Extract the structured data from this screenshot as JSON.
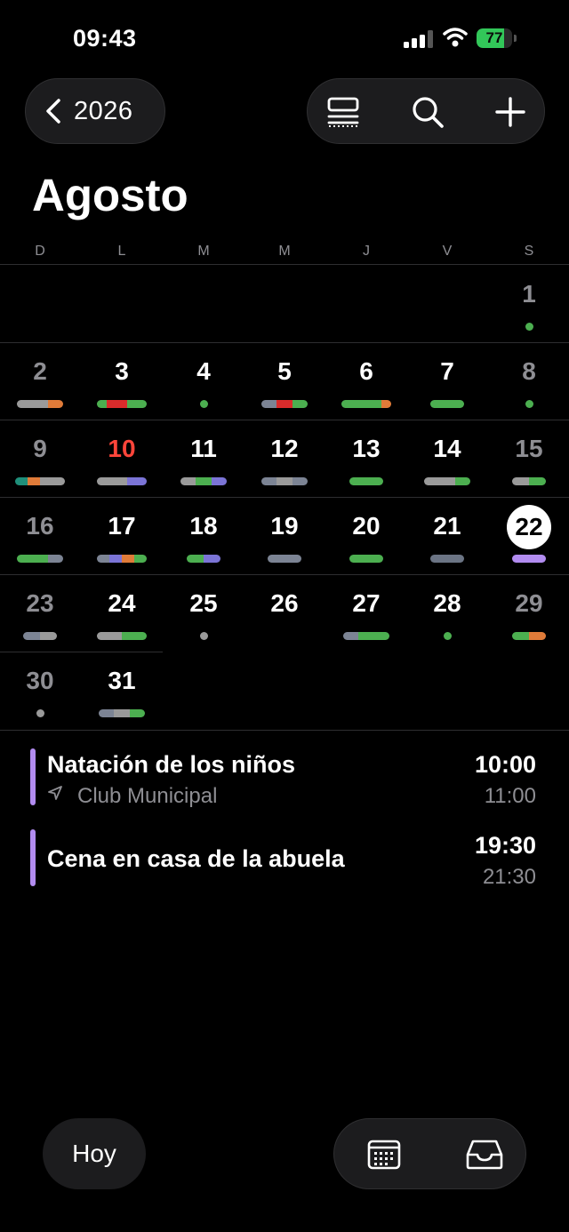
{
  "status_bar": {
    "time": "09:43",
    "battery": "77"
  },
  "header": {
    "back_label": "2026",
    "month": "Agosto"
  },
  "toolbar": {
    "icons": [
      "list-view-icon",
      "search-icon",
      "plus-icon"
    ]
  },
  "weekdays": [
    "D",
    "L",
    "M",
    "M",
    "J",
    "V",
    "S"
  ],
  "days": [
    {
      "d": "1",
      "dots": [
        "#4caf50"
      ]
    },
    {
      "d": "2",
      "bar": [
        "#9a9a9a",
        "#9a9a9a",
        "#e07b39"
      ]
    },
    {
      "d": "3",
      "bar": [
        "#4caf50",
        "#d92b2b",
        "#d92b2b",
        "#4caf50",
        "#4caf50"
      ]
    },
    {
      "d": "4",
      "dots": [
        "#4caf50"
      ]
    },
    {
      "d": "5",
      "bar": [
        "#7c8494",
        "#d92b2b",
        "#4caf50"
      ]
    },
    {
      "d": "6",
      "bar": [
        "#4caf50",
        "#4caf50",
        "#4caf50",
        "#4caf50",
        "#e07b39"
      ]
    },
    {
      "d": "7",
      "bar": [
        "#4caf50",
        "#4caf50"
      ]
    },
    {
      "d": "8",
      "dots": [
        "#4caf50"
      ]
    },
    {
      "d": "9",
      "bar": [
        "#1f8f7a",
        "#e07b39",
        "#9a9a9a",
        "#9a9a9a"
      ]
    },
    {
      "d": "10",
      "bar": [
        "#9a9a9a",
        "#9a9a9a",
        "#9a9a9a",
        "#7b74d6",
        "#7b74d6"
      ]
    },
    {
      "d": "11",
      "bar": [
        "#9a9a9a",
        "#4caf50",
        "#7b74d6"
      ]
    },
    {
      "d": "12",
      "bar": [
        "#7c8494",
        "#9a9a9a",
        "#7c8494"
      ]
    },
    {
      "d": "13",
      "bar": [
        "#4caf50",
        "#4caf50"
      ]
    },
    {
      "d": "14",
      "bar": [
        "#9a9a9a",
        "#9a9a9a",
        "#4caf50"
      ]
    },
    {
      "d": "15",
      "bar": [
        "#9a9a9a",
        "#4caf50"
      ]
    },
    {
      "d": "16",
      "bar": [
        "#4caf50",
        "#4caf50",
        "#7c8494"
      ]
    },
    {
      "d": "17",
      "bar": [
        "#7c8494",
        "#7b74d6",
        "#e07b39",
        "#4caf50"
      ]
    },
    {
      "d": "18",
      "bar": [
        "#4caf50",
        "#7b74d6"
      ]
    },
    {
      "d": "19",
      "bar": [
        "#7c8494",
        "#7c8494"
      ]
    },
    {
      "d": "20",
      "bar": [
        "#4caf50",
        "#4caf50"
      ]
    },
    {
      "d": "21",
      "bar": [
        "#6b7484",
        "#6b7484"
      ]
    },
    {
      "d": "22",
      "bar": [
        "#b28cf0",
        "#b28cf0"
      ],
      "selected": true
    },
    {
      "d": "23",
      "bar": [
        "#7c8494",
        "#9a9a9a"
      ]
    },
    {
      "d": "24",
      "bar": [
        "#9a9a9a",
        "#9a9a9a",
        "#4caf50",
        "#4caf50"
      ]
    },
    {
      "d": "25",
      "dots": [
        "#9a9a9a"
      ]
    },
    {
      "d": "26"
    },
    {
      "d": "27",
      "bar": [
        "#7c8494",
        "#4caf50",
        "#4caf50"
      ]
    },
    {
      "d": "28",
      "dots": [
        "#4caf50"
      ]
    },
    {
      "d": "29",
      "bar": [
        "#4caf50",
        "#e07b39"
      ]
    },
    {
      "d": "30",
      "dots": [
        "#9a9a9a"
      ]
    },
    {
      "d": "31",
      "bar": [
        "#7c8494",
        "#9a9a9a",
        "#4caf50"
      ]
    }
  ],
  "calendar": {
    "first_weekday_index": 6,
    "today": "10",
    "selected": "22"
  },
  "events": [
    {
      "title": "Natación de los niños",
      "location": "Club Municipal",
      "start": "10:00",
      "end": "11:00",
      "color": "#b28cf0"
    },
    {
      "title": "Cena en casa de la abuela",
      "location": "",
      "start": "19:30",
      "end": "21:30",
      "color": "#b28cf0"
    }
  ],
  "bottom": {
    "today_label": "Hoy",
    "icons": [
      "calendar-grid-icon",
      "inbox-icon"
    ]
  }
}
